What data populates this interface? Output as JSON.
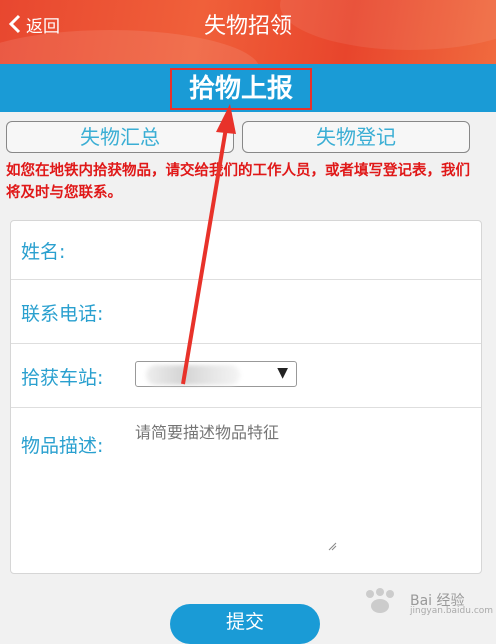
{
  "header": {
    "back_label": "返回",
    "title": "失物招领"
  },
  "section": {
    "title": "拾物上报"
  },
  "tabs": [
    {
      "label": "失物汇总"
    },
    {
      "label": "失物登记"
    }
  ],
  "notice": "如您在地铁内拾获物品，请交给我们的工作人员，或者填写登记表，我们将及时与您联系。",
  "form": {
    "name_label": "姓名:",
    "phone_label": "联系电话:",
    "station_label": "拾获车站:",
    "desc_label": "物品描述:",
    "desc_placeholder": "请简要描述物品特征",
    "submit_label": "提交"
  },
  "annotation": {
    "color": "#e8322a"
  },
  "watermark": {
    "text": "Bai 经验",
    "sub": "jingyan.baidu.com"
  }
}
